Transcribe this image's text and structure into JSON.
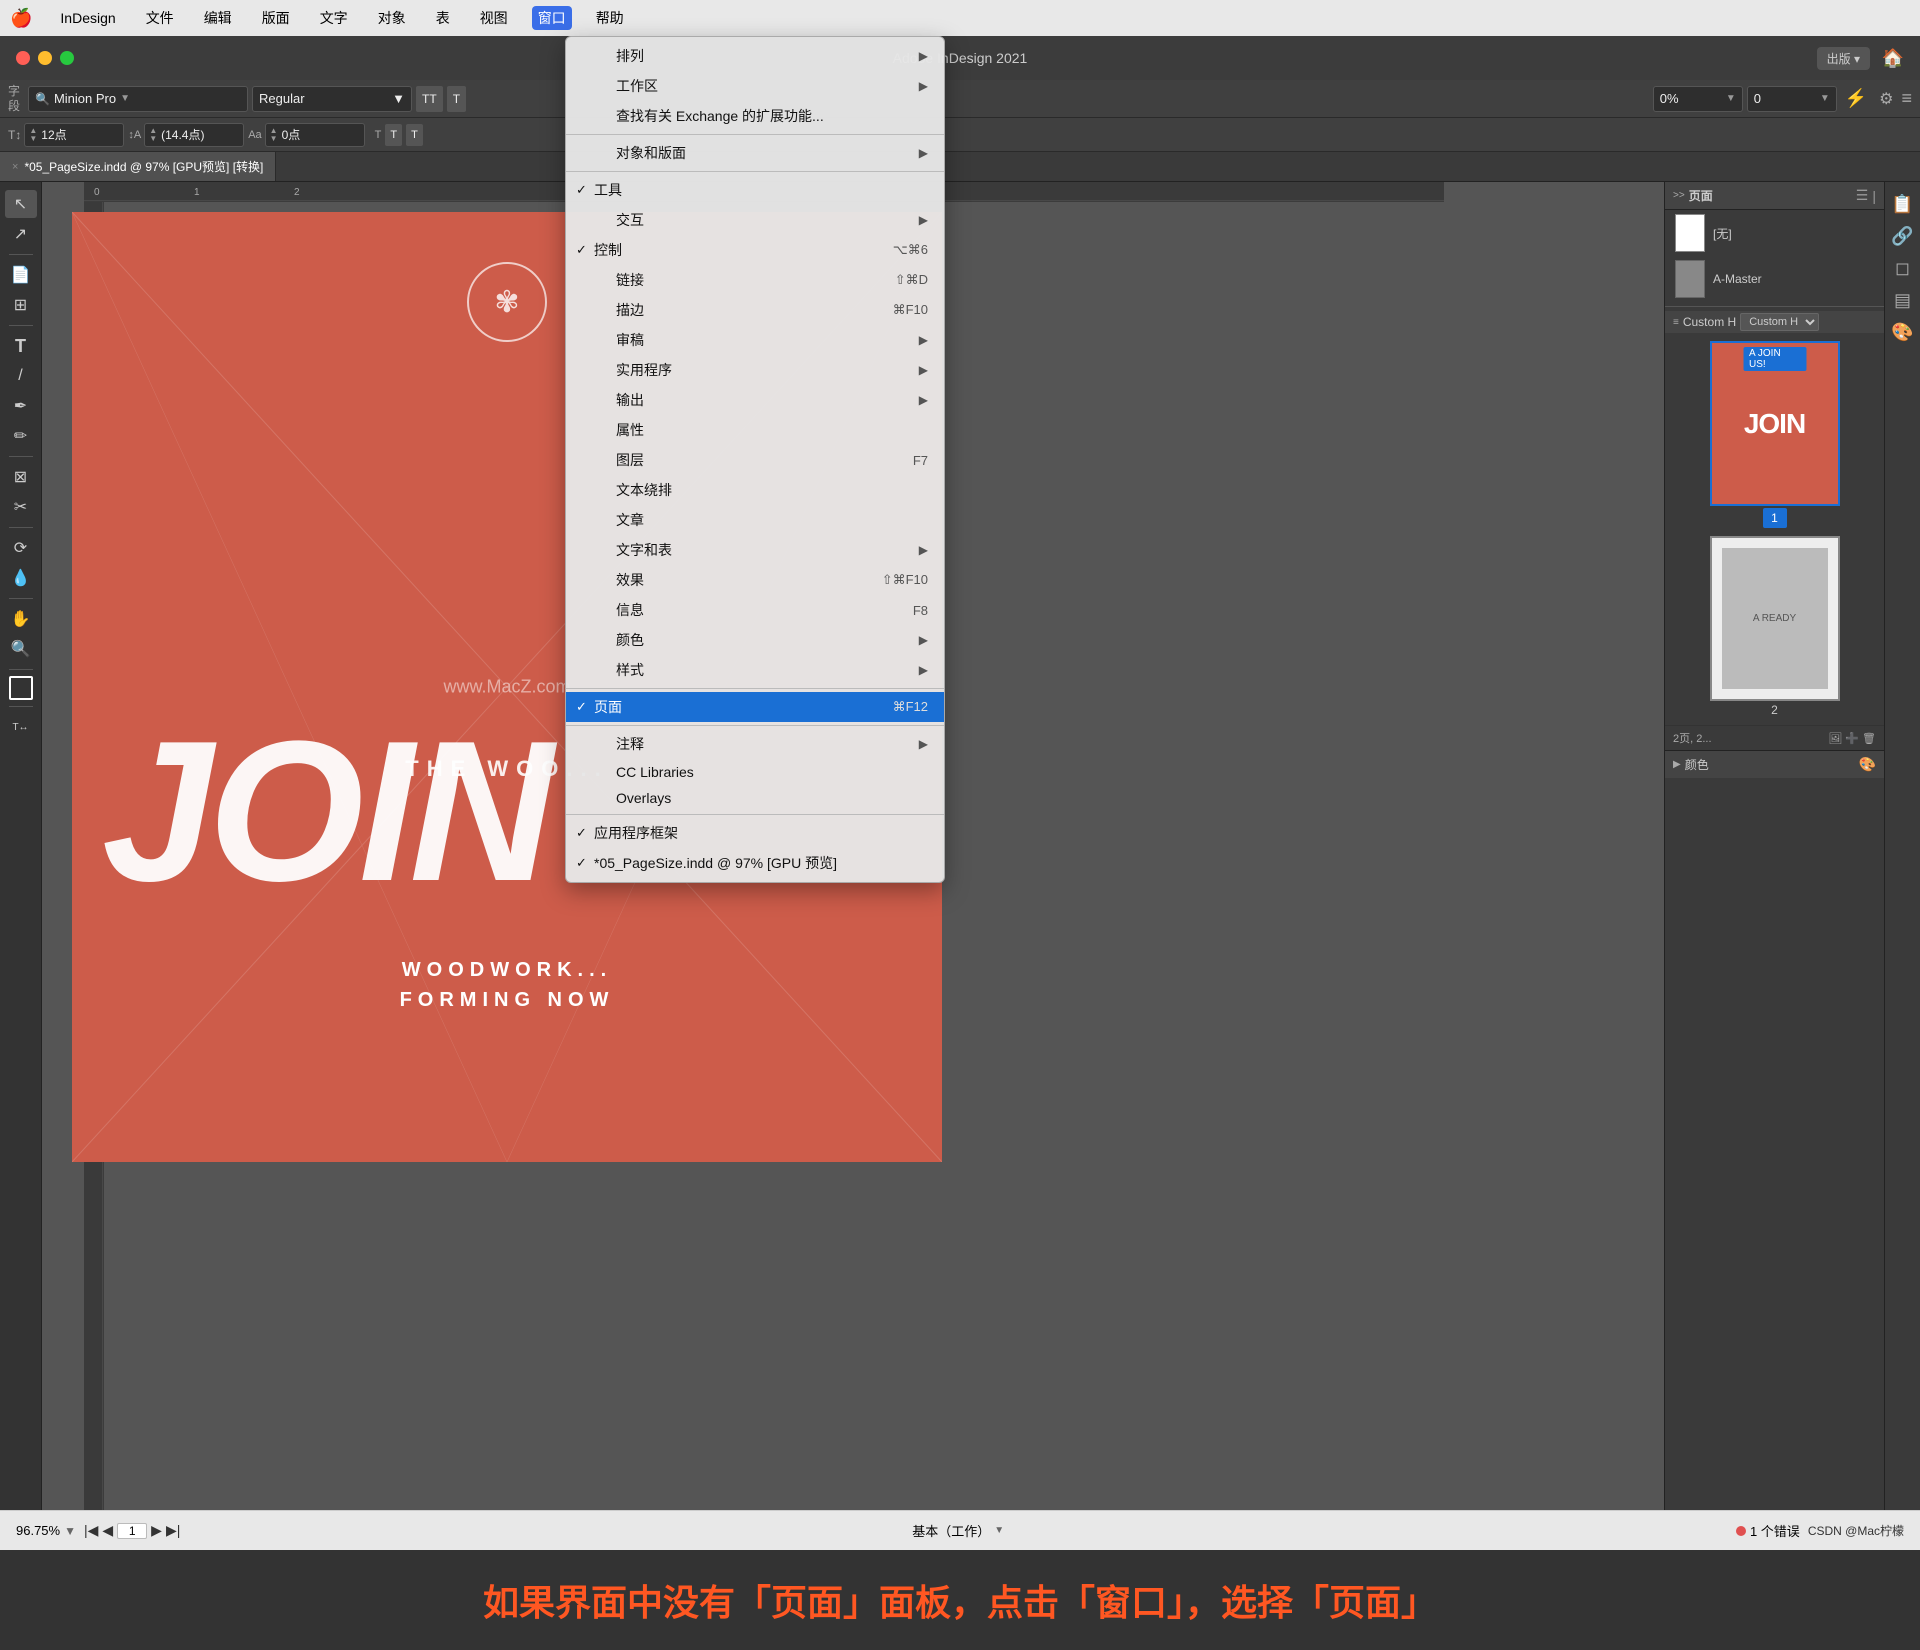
{
  "menubar": {
    "apple": "🍎",
    "items": [
      "InDesign",
      "文件",
      "编辑",
      "版面",
      "文字",
      "对象",
      "表",
      "视图",
      "窗口",
      "帮助"
    ],
    "active_item": "窗口"
  },
  "titlebar": {
    "title": "Adobe InDesign 2021",
    "publish_label": "出版 ▾"
  },
  "toolbar1": {
    "label_char": "字",
    "label_para": "段",
    "font_name": "Minion Pro",
    "font_style": "Regular",
    "T1": "TT",
    "T2": "T",
    "percent": "0%",
    "percent2": "0",
    "lightning": "⚡",
    "gear": "⚙",
    "menu": "≡"
  },
  "toolbar2": {
    "size1": "12点",
    "size2": "(14.4点)",
    "size3": "0点",
    "T_btn1": "T",
    "T_btn2": "T"
  },
  "tab": {
    "close": "×",
    "filename": "*05_PageSize.indd @ 97% [GPU预览] [转换]"
  },
  "ruler": {
    "marks": [
      "0",
      "1",
      "2"
    ]
  },
  "canvas": {
    "join_text": "JOIN",
    "subtitle1": "THE WOO...",
    "subtitle_bottom1": "WOODWORK...",
    "subtitle_bottom2": "FORMING NOW",
    "watermark": "www.MacZ.com",
    "emblem": "✾"
  },
  "pages_panel": {
    "title": "页面",
    "none_label": "[无]",
    "master_label": "A-Master",
    "page1_label": "1",
    "page2_label": "2",
    "status": "2页, 2..."
  },
  "custom_h": {
    "label": "Custom H"
  },
  "colors_panel": {
    "title": "颜色"
  },
  "window_menu": {
    "items": [
      {
        "label": "排列",
        "has_arrow": true,
        "check": false,
        "shortcut": ""
      },
      {
        "label": "工作区",
        "has_arrow": true,
        "check": false,
        "shortcut": ""
      },
      {
        "label": "查找有关 Exchange 的扩展功能...",
        "has_arrow": false,
        "check": false,
        "shortcut": ""
      },
      {
        "label": "separator",
        "type": "separator"
      },
      {
        "label": "对象和版面",
        "has_arrow": true,
        "check": false,
        "shortcut": ""
      },
      {
        "label": "separator",
        "type": "separator"
      },
      {
        "label": "工具",
        "has_arrow": false,
        "check": true,
        "shortcut": ""
      },
      {
        "label": "交互",
        "has_arrow": true,
        "check": false,
        "shortcut": ""
      },
      {
        "label": "控制",
        "has_arrow": false,
        "check": true,
        "shortcut": "⌥⌘6"
      },
      {
        "label": "链接",
        "has_arrow": false,
        "check": false,
        "shortcut": "⇧⌘D"
      },
      {
        "label": "描边",
        "has_arrow": false,
        "check": false,
        "shortcut": "⌘F10"
      },
      {
        "label": "审稿",
        "has_arrow": false,
        "check": false,
        "shortcut": ""
      },
      {
        "label": "实用程序",
        "has_arrow": true,
        "check": false,
        "shortcut": ""
      },
      {
        "label": "输出",
        "has_arrow": true,
        "check": false,
        "shortcut": ""
      },
      {
        "label": "属性",
        "has_arrow": false,
        "check": false,
        "shortcut": ""
      },
      {
        "label": "图层",
        "has_arrow": false,
        "check": false,
        "shortcut": "F7"
      },
      {
        "label": "文本绕排",
        "has_arrow": false,
        "check": false,
        "shortcut": ""
      },
      {
        "label": "文章",
        "has_arrow": false,
        "check": false,
        "shortcut": ""
      },
      {
        "label": "文字和表",
        "has_arrow": true,
        "check": false,
        "shortcut": ""
      },
      {
        "label": "效果",
        "has_arrow": false,
        "check": false,
        "shortcut": "⇧⌘F10"
      },
      {
        "label": "信息",
        "has_arrow": false,
        "check": false,
        "shortcut": "F8"
      },
      {
        "label": "颜色",
        "has_arrow": true,
        "check": false,
        "shortcut": ""
      },
      {
        "label": "样式",
        "has_arrow": true,
        "check": false,
        "shortcut": ""
      },
      {
        "label": "separator",
        "type": "separator"
      },
      {
        "label": "页面",
        "has_arrow": false,
        "check": true,
        "shortcut": "⌘F12",
        "highlighted": true
      },
      {
        "label": "separator",
        "type": "separator"
      },
      {
        "label": "注释",
        "has_arrow": true,
        "check": false,
        "shortcut": ""
      },
      {
        "label": "CC Libraries",
        "has_arrow": false,
        "check": false,
        "shortcut": ""
      },
      {
        "label": "Overlays",
        "has_arrow": false,
        "check": false,
        "shortcut": ""
      },
      {
        "label": "separator",
        "type": "separator"
      },
      {
        "label": "✓ 应用程序框架",
        "has_arrow": false,
        "check": false,
        "shortcut": ""
      },
      {
        "label": "✓ *05_PageSize.indd @ 97% [GPU 预览]",
        "has_arrow": false,
        "check": false,
        "shortcut": ""
      }
    ]
  },
  "bottombar": {
    "zoom": "96.75%",
    "page": "1",
    "workspace": "基本（工作）",
    "error": "1 个错误",
    "attribution": "CSDN @Mac柠檬"
  },
  "instruction": {
    "text": "如果界面中没有「页面」面板，点击「窗口」，选择「页面」"
  }
}
